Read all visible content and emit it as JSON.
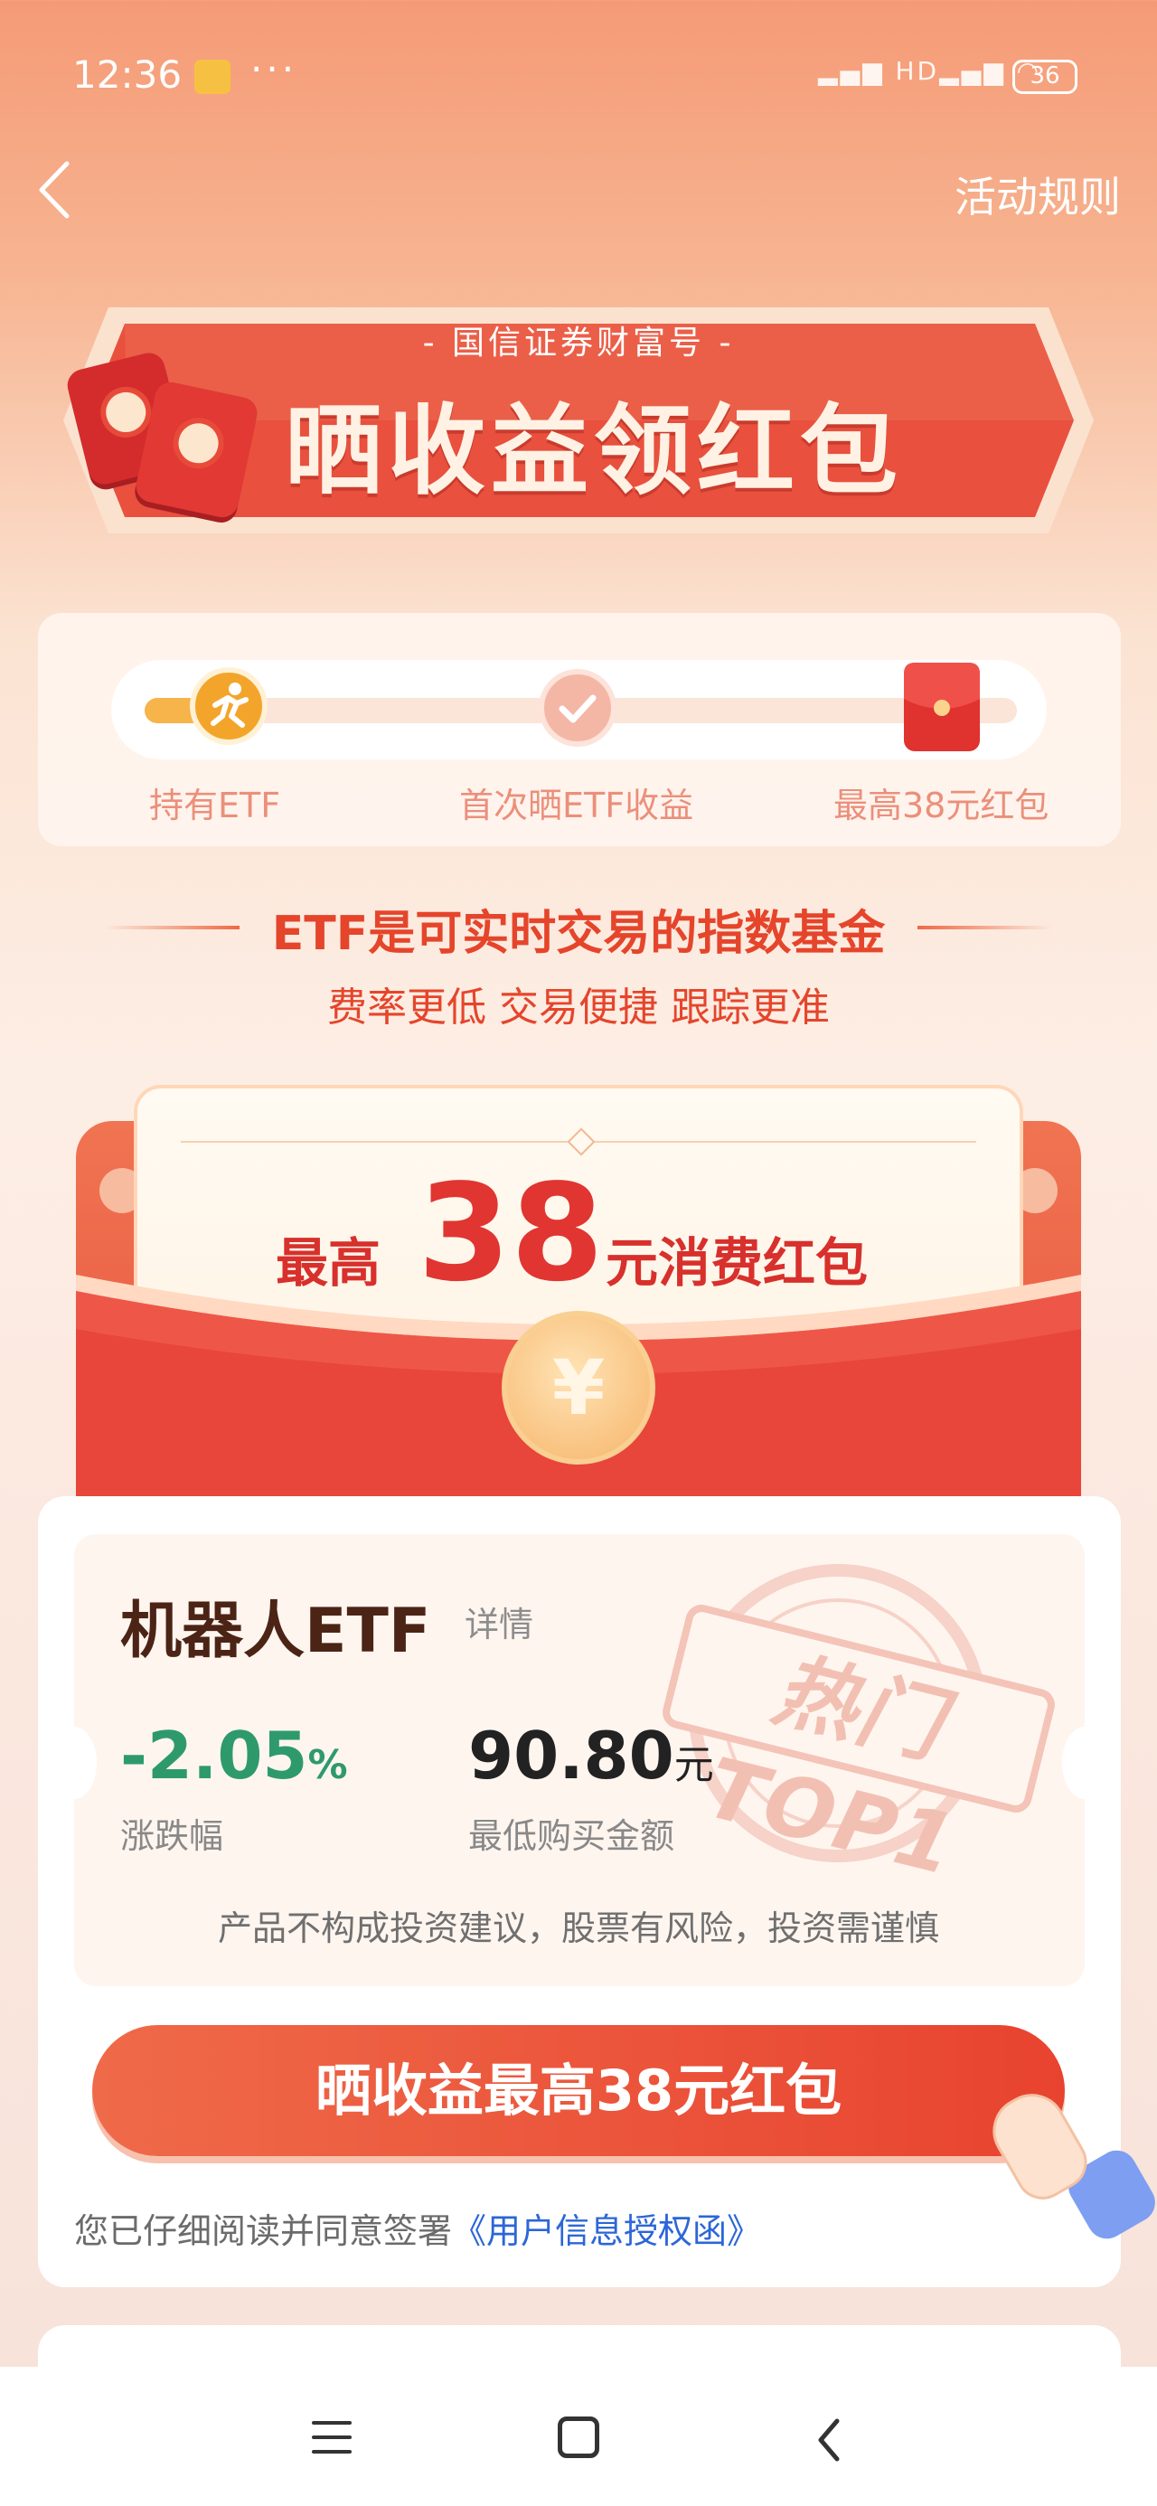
{
  "status_bar": {
    "time": "12:36",
    "dots": "···",
    "signal": "HD",
    "battery": "36"
  },
  "header": {
    "rules_label": "活动规则"
  },
  "banner": {
    "subtitle": "- 国信证券财富号 -",
    "title": "晒收益领红包"
  },
  "progress": {
    "steps": [
      {
        "label": "持有ETF",
        "state": "done"
      },
      {
        "label": "首次晒ETF收益",
        "state": "pending"
      },
      {
        "label": "最高38元红包",
        "state": "pending"
      }
    ],
    "completed_fraction": 0.05
  },
  "slogan": {
    "title": "ETF是可实时交易的指数基金",
    "subtitle": "费率更低 交易便捷 跟踪更准"
  },
  "envelope": {
    "prefix": "最高",
    "amount": "38",
    "suffix": "元消费红包",
    "coin_symbol": "¥"
  },
  "product": {
    "name": "机器人ETF",
    "detail_label": "详情",
    "stamp_text": "热门TOP1",
    "change_value": "-2.05",
    "change_unit": "%",
    "change_label": "涨跌幅",
    "price_value": "90.80",
    "price_unit": "元",
    "price_label": "最低购买金额",
    "disclaimer": "产品不构成投资建议，股票有风险，投资需谨慎"
  },
  "cta": {
    "label": "晒收益最高38元红包"
  },
  "agreement": {
    "prefix": "您已仔细阅读并同意签署",
    "link": "《用户信息授权函》"
  },
  "colors": {
    "accent_red": "#e8432f",
    "positive_green": "#2e9a6c",
    "link_blue": "#2c66d8"
  }
}
